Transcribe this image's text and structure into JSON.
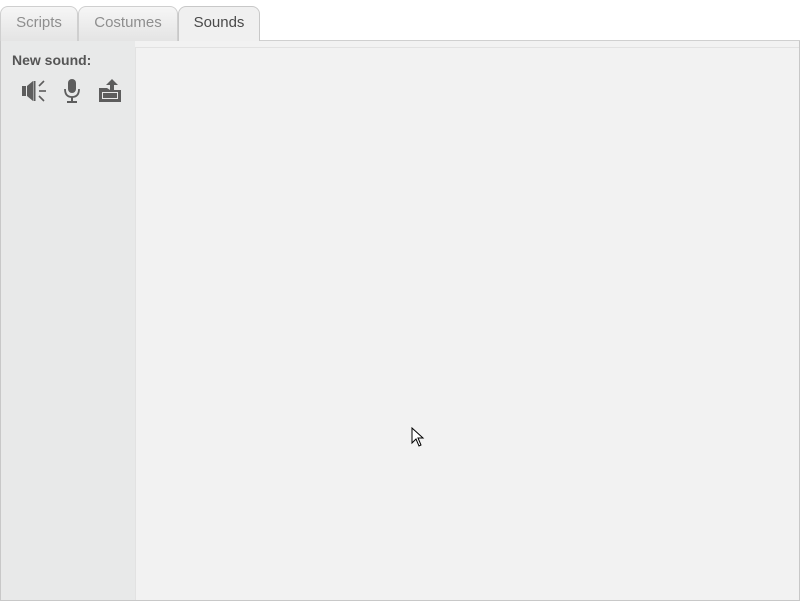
{
  "tabs": [
    {
      "label": "Scripts",
      "active": false
    },
    {
      "label": "Costumes",
      "active": false
    },
    {
      "label": "Sounds",
      "active": true
    }
  ],
  "sidebar": {
    "title": "New sound:",
    "buttons": [
      {
        "icon": "speaker-library-icon"
      },
      {
        "icon": "microphone-icon"
      },
      {
        "icon": "upload-folder-icon"
      }
    ]
  },
  "colors": {
    "icon": "#5d5d5d",
    "sidebar_bg": "#e8e9e9",
    "editor_bg": "#f2f2f2"
  }
}
